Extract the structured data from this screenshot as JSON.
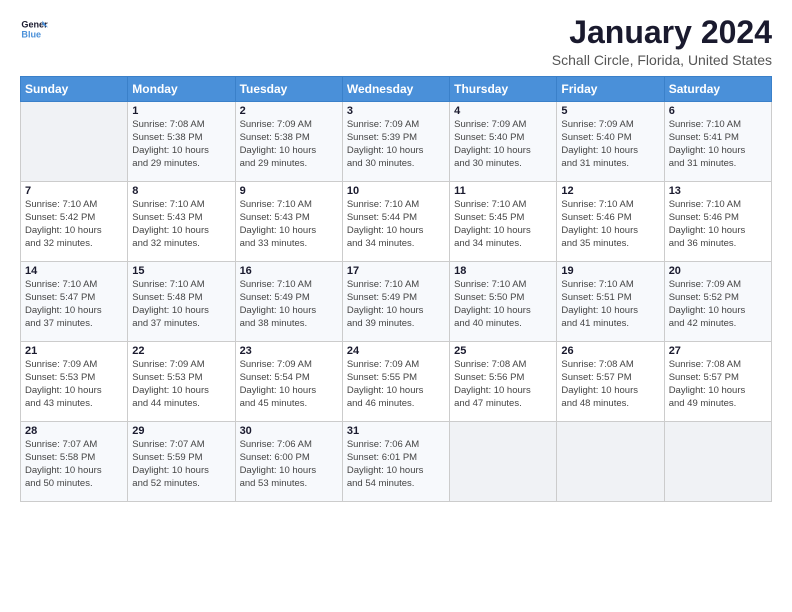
{
  "logo": {
    "line1": "General",
    "line2": "Blue"
  },
  "title": "January 2024",
  "subtitle": "Schall Circle, Florida, United States",
  "days_header": [
    "Sunday",
    "Monday",
    "Tuesday",
    "Wednesday",
    "Thursday",
    "Friday",
    "Saturday"
  ],
  "weeks": [
    [
      {
        "day": "",
        "info": ""
      },
      {
        "day": "1",
        "info": "Sunrise: 7:08 AM\nSunset: 5:38 PM\nDaylight: 10 hours\nand 29 minutes."
      },
      {
        "day": "2",
        "info": "Sunrise: 7:09 AM\nSunset: 5:38 PM\nDaylight: 10 hours\nand 29 minutes."
      },
      {
        "day": "3",
        "info": "Sunrise: 7:09 AM\nSunset: 5:39 PM\nDaylight: 10 hours\nand 30 minutes."
      },
      {
        "day": "4",
        "info": "Sunrise: 7:09 AM\nSunset: 5:40 PM\nDaylight: 10 hours\nand 30 minutes."
      },
      {
        "day": "5",
        "info": "Sunrise: 7:09 AM\nSunset: 5:40 PM\nDaylight: 10 hours\nand 31 minutes."
      },
      {
        "day": "6",
        "info": "Sunrise: 7:10 AM\nSunset: 5:41 PM\nDaylight: 10 hours\nand 31 minutes."
      }
    ],
    [
      {
        "day": "7",
        "info": "Sunrise: 7:10 AM\nSunset: 5:42 PM\nDaylight: 10 hours\nand 32 minutes."
      },
      {
        "day": "8",
        "info": "Sunrise: 7:10 AM\nSunset: 5:43 PM\nDaylight: 10 hours\nand 32 minutes."
      },
      {
        "day": "9",
        "info": "Sunrise: 7:10 AM\nSunset: 5:43 PM\nDaylight: 10 hours\nand 33 minutes."
      },
      {
        "day": "10",
        "info": "Sunrise: 7:10 AM\nSunset: 5:44 PM\nDaylight: 10 hours\nand 34 minutes."
      },
      {
        "day": "11",
        "info": "Sunrise: 7:10 AM\nSunset: 5:45 PM\nDaylight: 10 hours\nand 34 minutes."
      },
      {
        "day": "12",
        "info": "Sunrise: 7:10 AM\nSunset: 5:46 PM\nDaylight: 10 hours\nand 35 minutes."
      },
      {
        "day": "13",
        "info": "Sunrise: 7:10 AM\nSunset: 5:46 PM\nDaylight: 10 hours\nand 36 minutes."
      }
    ],
    [
      {
        "day": "14",
        "info": "Sunrise: 7:10 AM\nSunset: 5:47 PM\nDaylight: 10 hours\nand 37 minutes."
      },
      {
        "day": "15",
        "info": "Sunrise: 7:10 AM\nSunset: 5:48 PM\nDaylight: 10 hours\nand 37 minutes."
      },
      {
        "day": "16",
        "info": "Sunrise: 7:10 AM\nSunset: 5:49 PM\nDaylight: 10 hours\nand 38 minutes."
      },
      {
        "day": "17",
        "info": "Sunrise: 7:10 AM\nSunset: 5:49 PM\nDaylight: 10 hours\nand 39 minutes."
      },
      {
        "day": "18",
        "info": "Sunrise: 7:10 AM\nSunset: 5:50 PM\nDaylight: 10 hours\nand 40 minutes."
      },
      {
        "day": "19",
        "info": "Sunrise: 7:10 AM\nSunset: 5:51 PM\nDaylight: 10 hours\nand 41 minutes."
      },
      {
        "day": "20",
        "info": "Sunrise: 7:09 AM\nSunset: 5:52 PM\nDaylight: 10 hours\nand 42 minutes."
      }
    ],
    [
      {
        "day": "21",
        "info": "Sunrise: 7:09 AM\nSunset: 5:53 PM\nDaylight: 10 hours\nand 43 minutes."
      },
      {
        "day": "22",
        "info": "Sunrise: 7:09 AM\nSunset: 5:53 PM\nDaylight: 10 hours\nand 44 minutes."
      },
      {
        "day": "23",
        "info": "Sunrise: 7:09 AM\nSunset: 5:54 PM\nDaylight: 10 hours\nand 45 minutes."
      },
      {
        "day": "24",
        "info": "Sunrise: 7:09 AM\nSunset: 5:55 PM\nDaylight: 10 hours\nand 46 minutes."
      },
      {
        "day": "25",
        "info": "Sunrise: 7:08 AM\nSunset: 5:56 PM\nDaylight: 10 hours\nand 47 minutes."
      },
      {
        "day": "26",
        "info": "Sunrise: 7:08 AM\nSunset: 5:57 PM\nDaylight: 10 hours\nand 48 minutes."
      },
      {
        "day": "27",
        "info": "Sunrise: 7:08 AM\nSunset: 5:57 PM\nDaylight: 10 hours\nand 49 minutes."
      }
    ],
    [
      {
        "day": "28",
        "info": "Sunrise: 7:07 AM\nSunset: 5:58 PM\nDaylight: 10 hours\nand 50 minutes."
      },
      {
        "day": "29",
        "info": "Sunrise: 7:07 AM\nSunset: 5:59 PM\nDaylight: 10 hours\nand 52 minutes."
      },
      {
        "day": "30",
        "info": "Sunrise: 7:06 AM\nSunset: 6:00 PM\nDaylight: 10 hours\nand 53 minutes."
      },
      {
        "day": "31",
        "info": "Sunrise: 7:06 AM\nSunset: 6:01 PM\nDaylight: 10 hours\nand 54 minutes."
      },
      {
        "day": "",
        "info": ""
      },
      {
        "day": "",
        "info": ""
      },
      {
        "day": "",
        "info": ""
      }
    ]
  ]
}
